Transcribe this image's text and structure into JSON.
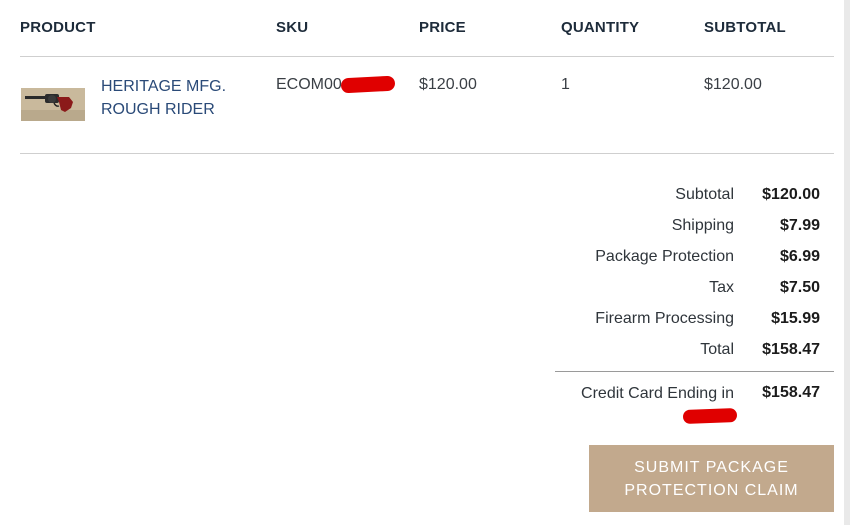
{
  "table": {
    "headers": {
      "product": "PRODUCT",
      "sku": "SKU",
      "price": "PRICE",
      "quantity": "QUANTITY",
      "subtotal": "SUBTOTAL"
    },
    "rows": [
      {
        "product_line1": "HERITAGE MFG.",
        "product_line2": "ROUGH RIDER",
        "sku_prefix": "ECOM00",
        "price": "$120.00",
        "quantity": "1",
        "subtotal": "$120.00",
        "thumbnail_icon": "revolver-image"
      }
    ]
  },
  "summary": {
    "items": [
      {
        "label": "Subtotal",
        "value": "$120.00"
      },
      {
        "label": "Shipping",
        "value": "$7.99"
      },
      {
        "label": "Package Protection",
        "value": "$6.99"
      },
      {
        "label": "Tax",
        "value": "$7.50"
      },
      {
        "label": "Firearm Processing",
        "value": "$15.99"
      },
      {
        "label": "Total",
        "value": "$158.47"
      }
    ],
    "payment_label": "Credit Card Ending in",
    "payment_value": "$158.47"
  },
  "actions": {
    "claim_line1": "SUBMIT PACKAGE",
    "claim_line2": "PROTECTION CLAIM"
  },
  "colors": {
    "accent_button": "#c2a98d",
    "link": "#2a4a78",
    "redaction": "#e00000"
  }
}
